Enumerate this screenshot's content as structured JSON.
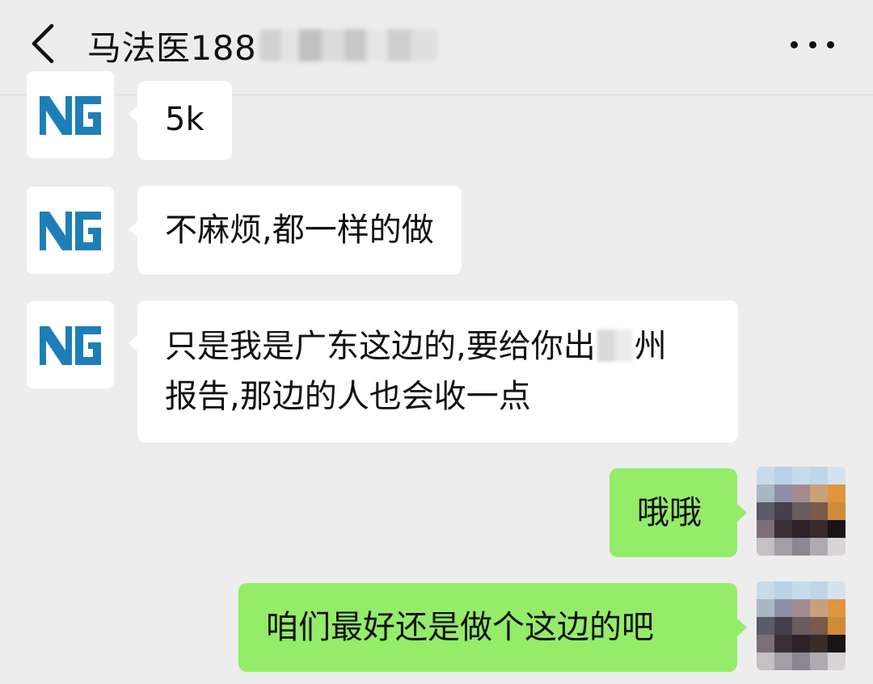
{
  "header": {
    "title": "马法医188",
    "title_redacted": true
  },
  "messages": [
    {
      "side": "in",
      "avatar": "NG-logo",
      "lines": [
        "5k"
      ]
    },
    {
      "side": "in",
      "avatar": "NG-logo",
      "lines": [
        "不麻烦,都一样的做"
      ]
    },
    {
      "side": "in",
      "avatar": "NG-logo",
      "lines_part": {
        "line1_before": "只是我是广东这边的,要给你出",
        "line1_after": "州",
        "line2": "报告,那边的人也会收一点"
      }
    },
    {
      "side": "out",
      "avatar": "pixelated-user",
      "lines": [
        "哦哦"
      ]
    },
    {
      "side": "out",
      "avatar": "pixelated-user",
      "lines": [
        "咱们最好还是做个这边的吧"
      ]
    }
  ],
  "colors": {
    "background": "#ededed",
    "incoming_bubble": "#ffffff",
    "outgoing_bubble": "#95ec69",
    "ng_logo": "#1e7fb8"
  },
  "icons": {
    "back": "chevron-left-icon",
    "more": "more-dots-icon"
  }
}
